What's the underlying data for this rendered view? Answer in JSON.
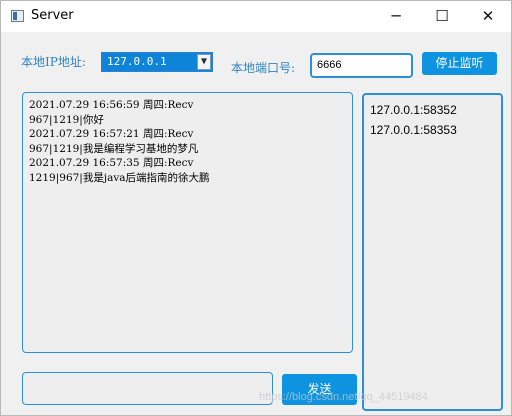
{
  "window": {
    "title": "Server",
    "controls": {
      "minimize": "─",
      "maximize": "☐",
      "close": "✕"
    }
  },
  "toolbar": {
    "ip_label": "本地IP地址:",
    "ip_value": "127.0.0.1",
    "ip_dropdown_icon": "chevron-down-icon",
    "port_label": "本地端口号:",
    "port_value": "6666",
    "stop_label": "停止监听"
  },
  "log": {
    "lines": [
      "2021.07.29 16:56:59 周四:Recv",
      "967|1219|你好",
      "2021.07.29 16:57:21 周四:Recv",
      "967|1219|我是编程学习基地的梦凡",
      "2021.07.29 16:57:35 周四:Recv",
      "1219|967|我是java后端指南的徐大鹏"
    ]
  },
  "clients": {
    "items": [
      "127.0.0.1:58352",
      "127.0.0.1:58353"
    ]
  },
  "message": {
    "value": "",
    "send_label": "发送"
  },
  "watermark": "https://blog.csdn.net/qq_44519484",
  "colors": {
    "accent": "#0e93e0",
    "border": "#2d8fd8",
    "label": "#2f83c4",
    "panel_bg": "#eeeeee"
  }
}
